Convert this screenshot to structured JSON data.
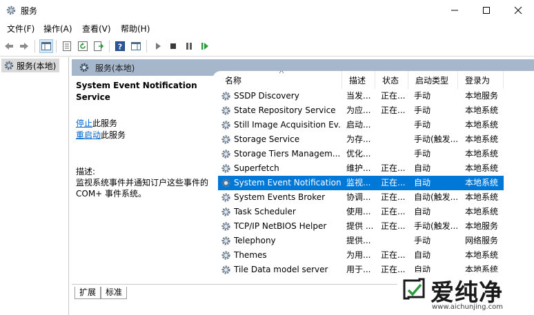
{
  "window": {
    "title": "服务",
    "minimize_icon": "minimize-icon",
    "maximize_icon": "maximize-icon",
    "close_icon": "close-icon"
  },
  "menu": [
    "文件(F)",
    "操作(A)",
    "查看(V)",
    "帮助(H)"
  ],
  "toolbar": {
    "icons": [
      "back-arrow-icon",
      "forward-arrow-icon",
      "console-tree-icon",
      "properties-icon",
      "refresh-icon",
      "export-list-icon",
      "help-icon",
      "action-pane-icon",
      "start-service-icon",
      "stop-service-icon",
      "pause-service-icon",
      "restart-service-icon"
    ]
  },
  "tree": {
    "item": "服务(本地)"
  },
  "main": {
    "header": "服务(本地)",
    "selected_service": "System Event Notification Service",
    "stop_link": "停止",
    "stop_suffix": "此服务",
    "restart_link": "重启动",
    "restart_suffix": "此服务",
    "desc_label": "描述:",
    "desc_text": "监视系统事件并通知订户这些事件的 COM+ 事件系统。"
  },
  "columns": [
    "名称",
    "描述",
    "状态",
    "启动类型",
    "登录为"
  ],
  "services": [
    {
      "name": "SSDP Discovery",
      "desc": "当发...",
      "status": "正在...",
      "startup": "手动",
      "logon": "本地服务"
    },
    {
      "name": "State Repository Service",
      "desc": "为应...",
      "status": "正在...",
      "startup": "手动",
      "logon": "本地系统"
    },
    {
      "name": "Still Image Acquisition Ev...",
      "desc": "启动...",
      "status": "",
      "startup": "手动",
      "logon": "本地系统"
    },
    {
      "name": "Storage Service",
      "desc": "为存...",
      "status": "",
      "startup": "手动(触发...",
      "logon": "本地系统"
    },
    {
      "name": "Storage Tiers Managem...",
      "desc": "优化...",
      "status": "",
      "startup": "手动",
      "logon": "本地系统"
    },
    {
      "name": "Superfetch",
      "desc": "维护...",
      "status": "正在...",
      "startup": "自动",
      "logon": "本地系统"
    },
    {
      "name": "System Event Notification...",
      "desc": "监视...",
      "status": "正在...",
      "startup": "自动",
      "logon": "本地系统"
    },
    {
      "name": "System Events Broker",
      "desc": "协调...",
      "status": "正在...",
      "startup": "自动(触发...",
      "logon": "本地系统"
    },
    {
      "name": "Task Scheduler",
      "desc": "使用...",
      "status": "正在...",
      "startup": "自动",
      "logon": "本地系统"
    },
    {
      "name": "TCP/IP NetBIOS Helper",
      "desc": "提供 ...",
      "status": "正在...",
      "startup": "手动(触发...",
      "logon": "本地服务"
    },
    {
      "name": "Telephony",
      "desc": "提供...",
      "status": "",
      "startup": "手动",
      "logon": "网络服务"
    },
    {
      "name": "Themes",
      "desc": "为用...",
      "status": "正在...",
      "startup": "自动",
      "logon": "本地系统"
    },
    {
      "name": "Tile Data model server",
      "desc": "用于...",
      "status": "正在...",
      "startup": "自动",
      "logon": "本地系统"
    }
  ],
  "selected_index": 6,
  "tabs": [
    "扩展",
    "标准"
  ],
  "watermark": {
    "text": "爱纯净",
    "url": "www.aichunjing.com"
  },
  "colors": {
    "selection": "#0078d7",
    "header": "#a6b7cc",
    "link": "#0066cc"
  }
}
